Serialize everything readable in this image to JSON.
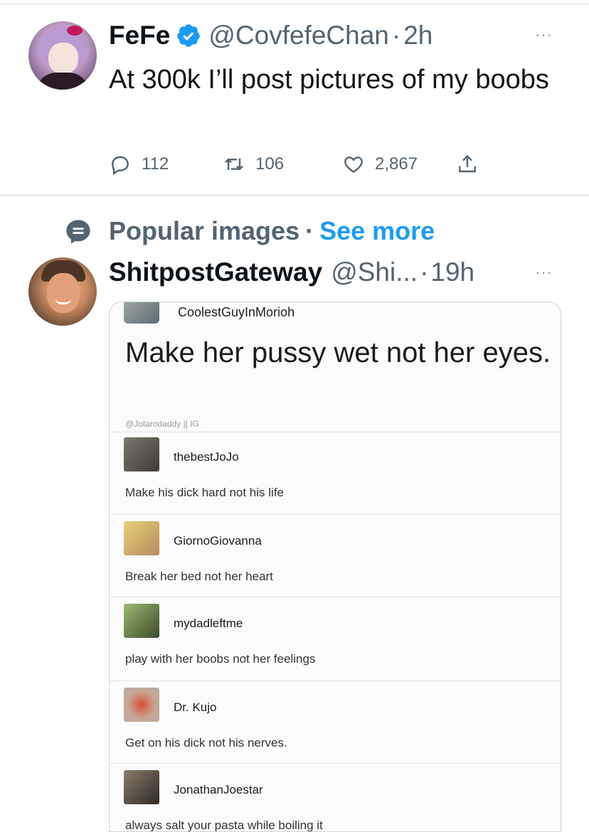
{
  "tweet1": {
    "display_name": "FeFe",
    "handle": "@CovfefeChan",
    "separator": "·",
    "time": "2h",
    "more": "···",
    "text": "At 300k I’ll post pictures of my boobs",
    "replies": "112",
    "retweets": "106",
    "likes": "2,867"
  },
  "popular": {
    "label": "Popular images",
    "separator": "·",
    "link": "See more"
  },
  "tweet2": {
    "display_name": "ShitpostGateway",
    "handle": "@Shi...",
    "separator": "·",
    "time": "19h",
    "more": "···"
  },
  "image": {
    "header_user": "CoolestGuyInMorioh",
    "headline": "Make her pussy wet not her eyes.",
    "credit": "@Jotarodaddy || IG",
    "comments": [
      {
        "user": "thebestJoJo",
        "text": "Make his dick hard not his life"
      },
      {
        "user": "GiornoGiovanna",
        "text": "Break her bed not her heart"
      },
      {
        "user": "mydadleftme",
        "text": "play with her boobs not her feelings"
      },
      {
        "user": "Dr. Kujo",
        "text": "Get on his dick not his nerves."
      },
      {
        "user": "JonathanJoestar",
        "text": "always salt your pasta while boiling it"
      }
    ]
  },
  "colors": {
    "accent": "#1d9bf0",
    "secondary_text": "#536471",
    "primary_text": "#0f1419"
  },
  "icons": [
    "verified-badge-icon",
    "reply-icon",
    "retweet-icon",
    "like-icon",
    "share-icon",
    "popular-images-icon",
    "more-options-icon"
  ]
}
